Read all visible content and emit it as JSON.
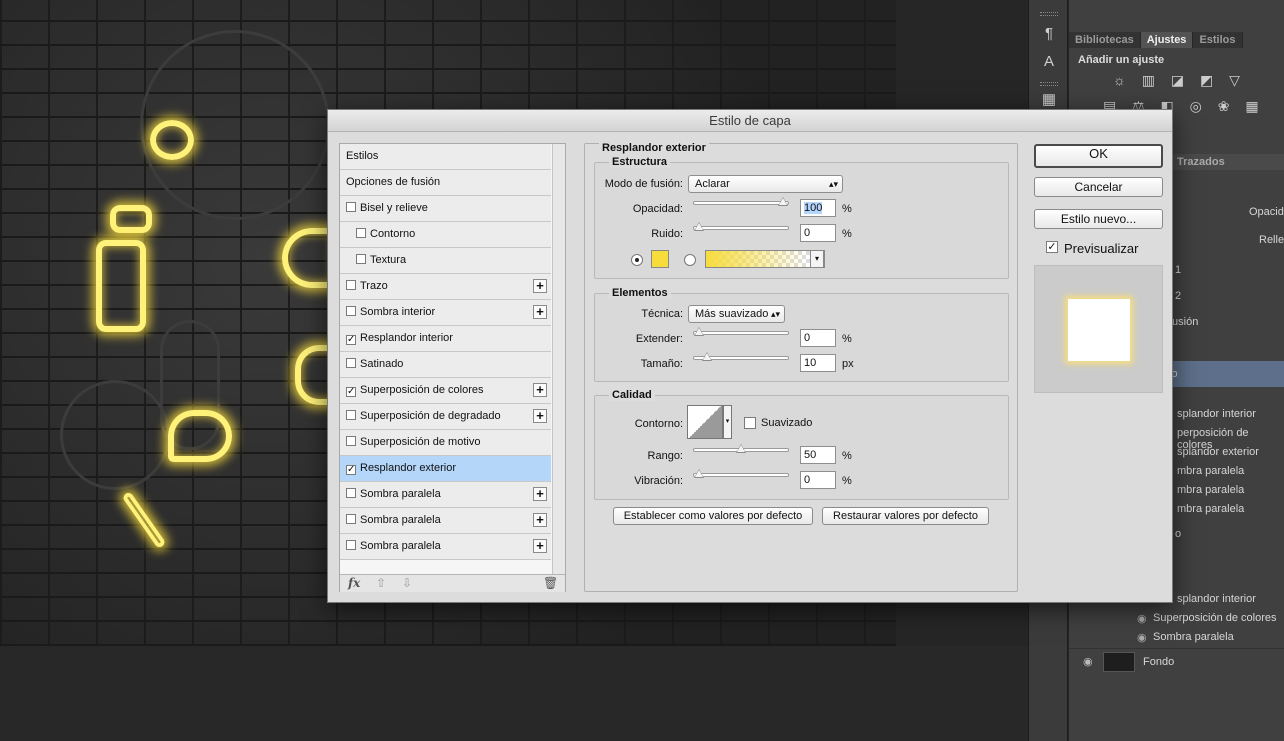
{
  "dialog": {
    "title": "Estilo de capa",
    "styles": [
      {
        "label": "Estilos",
        "checkbox": false,
        "checked": false,
        "plus": false,
        "indent": false,
        "selected": false
      },
      {
        "label": "Opciones de fusión",
        "checkbox": false,
        "checked": false,
        "plus": false,
        "indent": false,
        "selected": false
      },
      {
        "label": "Bisel y relieve",
        "checkbox": true,
        "checked": false,
        "plus": false,
        "indent": false,
        "selected": false
      },
      {
        "label": "Contorno",
        "checkbox": true,
        "checked": false,
        "plus": false,
        "indent": true,
        "selected": false
      },
      {
        "label": "Textura",
        "checkbox": true,
        "checked": false,
        "plus": false,
        "indent": true,
        "selected": false
      },
      {
        "label": "Trazo",
        "checkbox": true,
        "checked": false,
        "plus": true,
        "indent": false,
        "selected": false
      },
      {
        "label": "Sombra interior",
        "checkbox": true,
        "checked": false,
        "plus": true,
        "indent": false,
        "selected": false
      },
      {
        "label": "Resplandor interior",
        "checkbox": true,
        "checked": true,
        "plus": false,
        "indent": false,
        "selected": false
      },
      {
        "label": "Satinado",
        "checkbox": true,
        "checked": false,
        "plus": false,
        "indent": false,
        "selected": false
      },
      {
        "label": "Superposición de colores",
        "checkbox": true,
        "checked": true,
        "plus": true,
        "indent": false,
        "selected": false
      },
      {
        "label": "Superposición de degradado",
        "checkbox": true,
        "checked": false,
        "plus": true,
        "indent": false,
        "selected": false
      },
      {
        "label": "Superposición de motivo",
        "checkbox": true,
        "checked": false,
        "plus": false,
        "indent": false,
        "selected": false
      },
      {
        "label": "Resplandor exterior",
        "checkbox": true,
        "checked": true,
        "plus": false,
        "indent": false,
        "selected": true
      },
      {
        "label": "Sombra paralela",
        "checkbox": true,
        "checked": false,
        "plus": true,
        "indent": false,
        "selected": false
      },
      {
        "label": "Sombra paralela",
        "checkbox": true,
        "checked": false,
        "plus": true,
        "indent": false,
        "selected": false
      },
      {
        "label": "Sombra paralela",
        "checkbox": true,
        "checked": false,
        "plus": true,
        "indent": false,
        "selected": false
      }
    ],
    "footer": {
      "fx": "fx"
    },
    "section_title": "Resplandor exterior",
    "estructura": {
      "title": "Estructura",
      "blend_label": "Modo de fusión:",
      "blend_value": "Aclarar",
      "opacity_label": "Opacidad:",
      "opacity_value": "100",
      "opacity_unit": "%",
      "opacity_level": 1.0,
      "noise_label": "Ruido:",
      "noise_value": "0",
      "noise_unit": "%",
      "noise_level": 0.0,
      "glow_color": "#f7dc3c"
    },
    "elementos": {
      "title": "Elementos",
      "technique_label": "Técnica:",
      "technique_value": "Más suavizado",
      "spread_label": "Extender:",
      "spread_value": "0",
      "spread_unit": "%",
      "spread_level": 0.0,
      "size_label": "Tamaño:",
      "size_value": "10",
      "size_unit": "px",
      "size_level": 0.1
    },
    "calidad": {
      "title": "Calidad",
      "contour_label": "Contorno:",
      "antialias_label": "Suavizado",
      "range_label": "Rango:",
      "range_value": "50",
      "range_unit": "%",
      "range_level": 0.5,
      "jitter_label": "Vibración:",
      "jitter_value": "0",
      "jitter_unit": "%",
      "jitter_level": 0.0
    },
    "default_button": "Establecer como valores por defecto",
    "reset_button": "Restaurar valores por defecto",
    "ok": "OK",
    "cancel": "Cancelar",
    "new_style": "Estilo nuevo...",
    "preview_label": "Previsualizar"
  },
  "panel": {
    "tabs": [
      "Bibliotecas",
      "Ajustes",
      "Estilos"
    ],
    "adjust_title": "Añadir un ajuste",
    "paths_tab": "Trazados",
    "opacity_partial": "Opacid",
    "fill_partial": "Relle",
    "layer_fragments": [
      "1",
      "2",
      "fusión",
      "lo",
      "splandor interior",
      "perposición de colores",
      "splandor exterior",
      "mbra paralela",
      "mbra paralela",
      "mbra paralela",
      "o",
      "splandor interior"
    ],
    "effects": [
      "Superposición de colores",
      "Sombra paralela"
    ],
    "bottom_layer": "Fondo"
  }
}
